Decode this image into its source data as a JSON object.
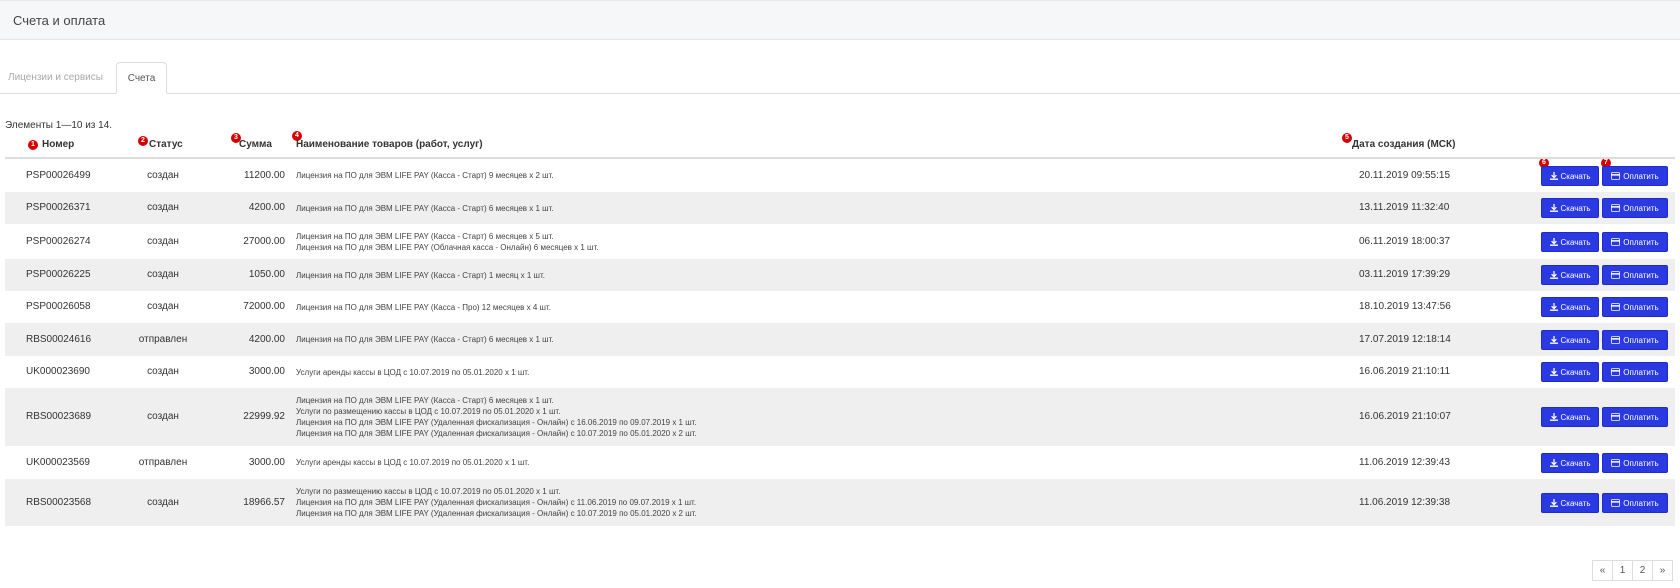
{
  "page": {
    "title": "Счета и оплата"
  },
  "tabs": [
    {
      "label": "Лицензии и сервисы",
      "active": false
    },
    {
      "label": "Счета",
      "active": true
    }
  ],
  "summary": "Элементы 1—10 из 14.",
  "columns": {
    "number": "Номер",
    "status": "Статус",
    "sum": "Сумма",
    "name": "Наименование товаров (работ, услуг)",
    "date": "Дата создания (МСК)"
  },
  "markers": [
    "1",
    "2",
    "3",
    "4",
    "5",
    "6",
    "7"
  ],
  "actions": {
    "download": "Скачать",
    "pay": "Оплатить"
  },
  "rows": [
    {
      "number": "PSP00026499",
      "status": "создан",
      "sum": "11200.00",
      "items": [
        "Лицензия на ПО для ЭВМ LIFE PAY (Касса - Старт) 9 месяцев x 2 шт."
      ],
      "date": "20.11.2019 09:55:15"
    },
    {
      "number": "PSP00026371",
      "status": "создан",
      "sum": "4200.00",
      "items": [
        "Лицензия на ПО для ЭВМ LIFE PAY (Касса - Старт) 6 месяцев x 1 шт."
      ],
      "date": "13.11.2019 11:32:40"
    },
    {
      "number": "PSP00026274",
      "status": "создан",
      "sum": "27000.00",
      "items": [
        "Лицензия на ПО для ЭВМ LIFE PAY (Касса - Старт) 6 месяцев x 5 шт.",
        "Лицензия на ПО для ЭВМ LIFE PAY (Облачная касса - Онлайн) 6 месяцев x 1 шт."
      ],
      "date": "06.11.2019 18:00:37"
    },
    {
      "number": "PSP00026225",
      "status": "создан",
      "sum": "1050.00",
      "items": [
        "Лицензия на ПО для ЭВМ LIFE PAY (Касса - Старт) 1 месяц x 1 шт."
      ],
      "date": "03.11.2019 17:39:29"
    },
    {
      "number": "PSP00026058",
      "status": "создан",
      "sum": "72000.00",
      "items": [
        "Лицензия на ПО для ЭВМ LIFE PAY (Касса - Про) 12 месяцев x 4 шт."
      ],
      "date": "18.10.2019 13:47:56"
    },
    {
      "number": "RBS00024616",
      "status": "отправлен",
      "sum": "4200.00",
      "items": [
        "Лицензия на ПО для ЭВМ LIFE PAY (Касса - Старт) 6 месяцев x 1 шт."
      ],
      "date": "17.07.2019 12:18:14"
    },
    {
      "number": "UK000023690",
      "status": "создан",
      "sum": "3000.00",
      "items": [
        "Услуги аренды кассы в ЦОД с 10.07.2019 по 05.01.2020 x 1 шт."
      ],
      "date": "16.06.2019 21:10:11"
    },
    {
      "number": "RBS00023689",
      "status": "создан",
      "sum": "22999.92",
      "items": [
        "Лицензия на ПО для ЭВМ LIFE PAY (Касса - Старт) 6 месяцев x 1 шт.",
        "Услуги по размещению кассы в ЦОД с 10.07.2019 по 05.01.2020 x 1 шт.",
        "Лицензия на ПО для ЭВМ LIFE PAY (Удаленная фискализация - Онлайн) с 16.06.2019 по 09.07.2019 x 1 шт.",
        "Лицензия на ПО для ЭВМ LIFE PAY (Удаленная фискализация - Онлайн) с 10.07.2019 по 05.01.2020 x 2 шт."
      ],
      "date": "16.06.2019 21:10:07"
    },
    {
      "number": "UK000023569",
      "status": "отправлен",
      "sum": "3000.00",
      "items": [
        "Услуги аренды кассы в ЦОД с 10.07.2019 по 05.01.2020 x 1 шт."
      ],
      "date": "11.06.2019 12:39:43"
    },
    {
      "number": "RBS00023568",
      "status": "создан",
      "sum": "18966.57",
      "items": [
        "Услуги по размещению кассы в ЦОД с 10.07.2019 по 05.01.2020 x 1 шт.",
        "Лицензия на ПО для ЭВМ LIFE PAY (Удаленная фискализация - Онлайн) с 11.06.2019 по 09.07.2019 x 1 шт.",
        "Лицензия на ПО для ЭВМ LIFE PAY (Удаленная фискализация - Онлайн) с 10.07.2019 по 05.01.2020 x 2 шт."
      ],
      "date": "11.06.2019 12:39:38"
    }
  ],
  "pagination": {
    "prev": "«",
    "pages": [
      "1",
      "2"
    ],
    "next": "»"
  },
  "colors": {
    "button": "#2a3ae0",
    "marker": "#d40000",
    "alt_row": "#efefef"
  },
  "icons": {
    "download": "download-icon",
    "pay": "credit-card-icon"
  }
}
